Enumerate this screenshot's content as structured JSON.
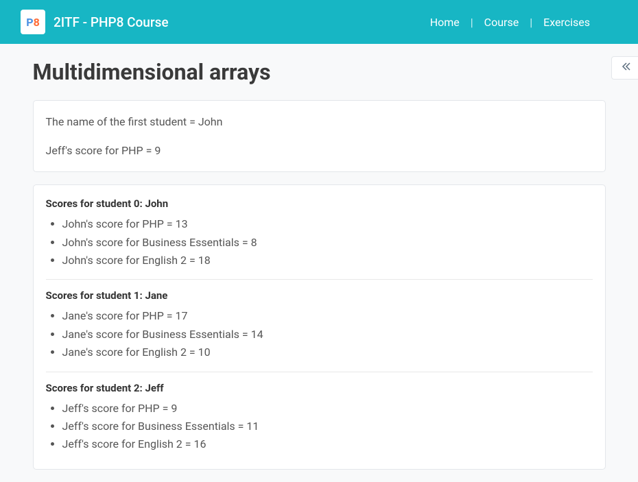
{
  "header": {
    "logo_p": "P",
    "logo_8": "8",
    "title": "2ITF - PHP8 Course"
  },
  "nav": {
    "home": "Home",
    "course": "Course",
    "exercises": "Exercises",
    "sep": "|"
  },
  "page": {
    "title": "Multidimensional arrays"
  },
  "intro": {
    "line1": "The name of the first student = John",
    "line2": "Jeff's score for PHP = 9"
  },
  "students": [
    {
      "heading": "Scores for student 0: John",
      "scores": [
        "John's score for PHP = 13",
        "John's score for Business Essentials = 8",
        "John's score for English 2 = 18"
      ]
    },
    {
      "heading": "Scores for student 1: Jane",
      "scores": [
        "Jane's score for PHP = 17",
        "Jane's score for Business Essentials = 14",
        "Jane's score for English 2 = 10"
      ]
    },
    {
      "heading": "Scores for student 2: Jeff",
      "scores": [
        "Jeff's score for PHP = 9",
        "Jeff's score for Business Essentials = 11",
        "Jeff's score for English 2 = 16"
      ]
    }
  ]
}
